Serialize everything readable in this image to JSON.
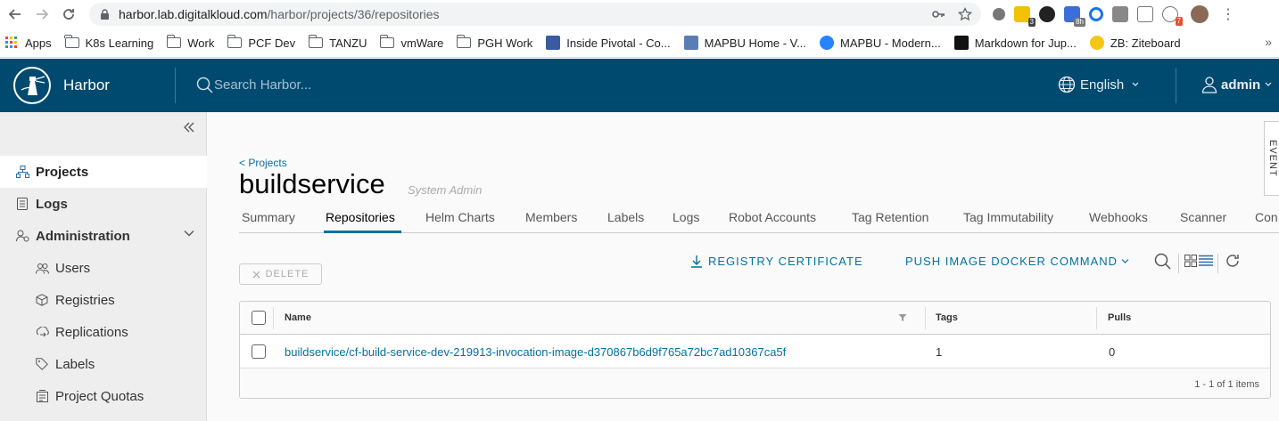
{
  "browser": {
    "url_host": "harbor.lab.digitalkloud.com",
    "url_path": "/harbor/projects/36/repositories",
    "extension_badges": [
      "3",
      "8h",
      "7"
    ]
  },
  "bookmarks": [
    {
      "label": "Apps",
      "type": "apps"
    },
    {
      "label": "K8s Learning",
      "type": "folder"
    },
    {
      "label": "Work",
      "type": "folder"
    },
    {
      "label": "PCF Dev",
      "type": "folder"
    },
    {
      "label": "TANZU",
      "type": "folder"
    },
    {
      "label": "vmWare",
      "type": "folder"
    },
    {
      "label": "PGH Work",
      "type": "folder"
    },
    {
      "label": "Inside Pivotal - Co...",
      "type": "site",
      "color": "#3b5ba0"
    },
    {
      "label": "MAPBU Home - V...",
      "type": "site",
      "color": "#5a7db5"
    },
    {
      "label": "MAPBU - Modern...",
      "type": "site",
      "color": "#2684ff"
    },
    {
      "label": "Markdown for Jup...",
      "type": "site",
      "color": "#111111"
    },
    {
      "label": "ZB: Ziteboard",
      "type": "site",
      "color": "#f5c518"
    }
  ],
  "header": {
    "brand": "Harbor",
    "search_placeholder": "Search Harbor...",
    "language": "English",
    "user": "admin",
    "bg_color": "#004a70"
  },
  "sidebar": {
    "items": [
      {
        "label": "Projects",
        "icon": "projects-icon",
        "active": true
      },
      {
        "label": "Logs",
        "icon": "logs-icon"
      },
      {
        "label": "Administration",
        "icon": "administration-icon",
        "expanded": true
      },
      {
        "label": "Users",
        "icon": "users-icon"
      },
      {
        "label": "Registries",
        "icon": "registries-icon"
      },
      {
        "label": "Replications",
        "icon": "replications-icon"
      },
      {
        "label": "Labels",
        "icon": "labels-icon"
      },
      {
        "label": "Project Quotas",
        "icon": "quotas-icon"
      }
    ]
  },
  "project": {
    "back_link": "< Projects",
    "name": "buildservice",
    "role": "System Admin"
  },
  "tabs": [
    {
      "label": "Summary"
    },
    {
      "label": "Repositories",
      "active": true
    },
    {
      "label": "Helm Charts"
    },
    {
      "label": "Members"
    },
    {
      "label": "Labels"
    },
    {
      "label": "Logs"
    },
    {
      "label": "Robot Accounts"
    },
    {
      "label": "Tag Retention"
    },
    {
      "label": "Tag Immutability"
    },
    {
      "label": "Webhooks"
    },
    {
      "label": "Scanner"
    },
    {
      "label": "Con"
    }
  ],
  "event_tab": "EVENT",
  "toolbar": {
    "delete": "DELETE",
    "registry_certificate": "REGISTRY CERTIFICATE",
    "push_command": "PUSH IMAGE DOCKER COMMAND"
  },
  "table": {
    "columns": [
      "Name",
      "Tags",
      "Pulls"
    ],
    "rows": [
      {
        "name": "buildservice/cf-build-service-dev-219913-invocation-image-d370867b6d9f765a72bc7ad10367ca5f",
        "tags": "1",
        "pulls": "0"
      }
    ],
    "footer": "1 - 1 of 1 items"
  },
  "accent_color": "#0072a3"
}
